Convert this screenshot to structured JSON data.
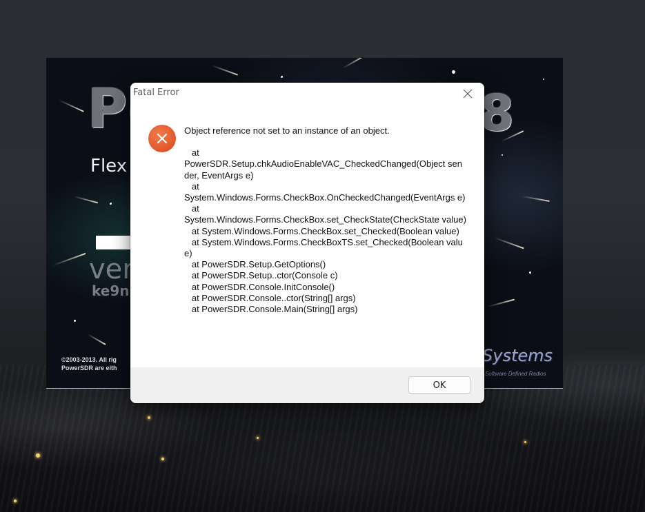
{
  "dialog": {
    "title": "Fatal Error",
    "close_icon": "close-icon",
    "error_icon": "error-circle-x-icon",
    "accent_color": "#e2542a",
    "headline": "Object reference not set to an instance of an object.",
    "stack_trace": "   at\nPowerSDR.Setup.chkAudioEnableVAC_CheckedChanged(Object sender, EventArgs e)\n   at\nSystem.Windows.Forms.CheckBox.OnCheckedChanged(EventArgs e)\n   at\nSystem.Windows.Forms.CheckBox.set_CheckState(CheckState value)\n   at System.Windows.Forms.CheckBox.set_Checked(Boolean value)\n   at System.Windows.Forms.CheckBoxTS.set_Checked(Boolean value)\n   at PowerSDR.Setup.GetOptions()\n   at PowerSDR.Setup..ctor(Console c)\n   at PowerSDR.Console.InitConsole()\n   at PowerSDR.Console..ctor(String[] args)\n   at PowerSDR.Console.Main(String[] args)",
    "ok_label": "OK"
  },
  "splash": {
    "logo_left": "Po",
    "logo_right": "8",
    "flex_text": "Flex",
    "version_text": "ver",
    "callsign_text": "ke9n",
    "copyright_line1": "©2003-2013. All rig",
    "copyright_line2": "PowerSDR are eith",
    "brand_text": "Systems",
    "brand_sub": "Software Defined Radios"
  }
}
